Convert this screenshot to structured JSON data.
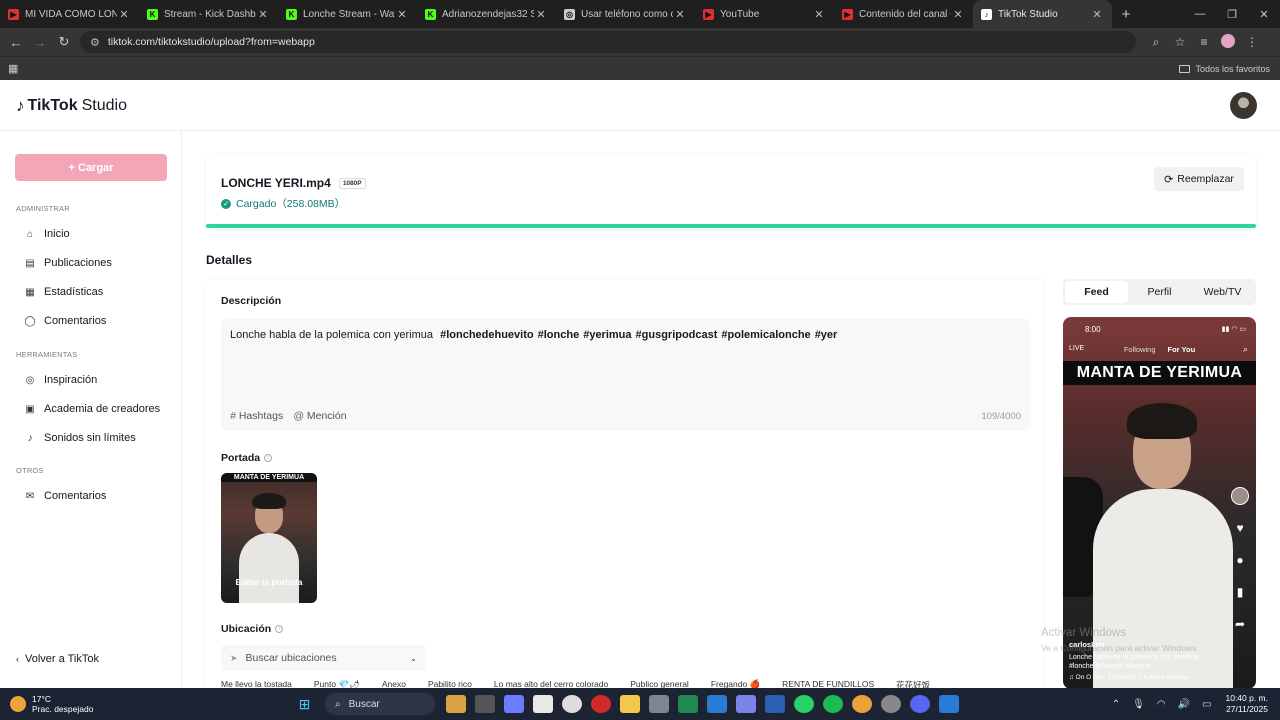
{
  "browser": {
    "tabs": [
      {
        "title": "MI VIDA COMO LONCHE",
        "color": "#e03131",
        "glyph": "▶"
      },
      {
        "title": "Stream - Kick Dashboard",
        "color": "#53fc18",
        "glyph": "K"
      },
      {
        "title": "Lonche Stream - Watch Li",
        "color": "#53fc18",
        "glyph": "K"
      },
      {
        "title": "Adrianozendejas32 Stream",
        "color": "#53fc18",
        "glyph": "K"
      },
      {
        "title": "Usar teléfono como cáma",
        "color": "#cccccc",
        "glyph": "◎"
      },
      {
        "title": "YouTube",
        "color": "#e03131",
        "glyph": "▶"
      },
      {
        "title": "Contenido del canal - You",
        "color": "#e03131",
        "glyph": "▶"
      },
      {
        "title": "TikTok Studio",
        "color": "#ffffff",
        "glyph": "♪"
      }
    ],
    "url": "tiktok.com/tiktokstudio/upload?from=webapp",
    "bookmarks_all": "Todos los favoritos"
  },
  "header": {
    "logo_bold": "TikTok",
    "logo_light": "Studio"
  },
  "sidebar": {
    "upload_label": "+ Cargar",
    "sections": [
      {
        "label": "ADMINISTRAR",
        "items": [
          {
            "label": "Inicio",
            "icon": "home-icon",
            "glyph": "⌂"
          },
          {
            "label": "Publicaciones",
            "icon": "posts-icon",
            "glyph": "▤"
          },
          {
            "label": "Estadísticas",
            "icon": "analytics-icon",
            "glyph": "▦"
          },
          {
            "label": "Comentarios",
            "icon": "comments-icon",
            "glyph": "◯"
          }
        ]
      },
      {
        "label": "HERRAMIENTAS",
        "items": [
          {
            "label": "Inspiración",
            "icon": "inspiration-icon",
            "glyph": "◎"
          },
          {
            "label": "Academia de creadores",
            "icon": "academy-icon",
            "glyph": "▣"
          },
          {
            "label": "Sonidos sin límites",
            "icon": "music-icon",
            "glyph": "♪"
          }
        ]
      },
      {
        "label": "OTROS",
        "items": [
          {
            "label": "Comentarios",
            "icon": "feedback-icon",
            "glyph": "✉"
          }
        ]
      }
    ],
    "back_label": "Volver a TikTok"
  },
  "file": {
    "name": "LONCHE YERI.mp4",
    "quality": "1080P",
    "status": "Cargado（258.08MB）",
    "replace_label": "Reemplazar",
    "progress_pct": 100
  },
  "details": {
    "title": "Detalles",
    "description_label": "Descripción",
    "description_text": "Lonche habla de la polemica con yerimua",
    "description_tags": [
      "#lonchedehuevito",
      "#lonche",
      "#yerimua",
      "#gusgripodcast",
      "#polemicalonche",
      "#yer"
    ],
    "hashtags_label": "Hashtags",
    "mention_label": "Mención",
    "counter": "109/4000",
    "cover_label": "Portada",
    "cover_title": "MANTA DE YERIMUA",
    "cover_edit": "Editar la portada",
    "location_label": "Ubicación",
    "location_placeholder": "Buscar ubicaciones",
    "location_chips": [
      "Me llevo la tostada",
      "Punto 💎🌶",
      "Anexo",
      "Pabilito rico",
      "Lo mas alto del cerro colorado",
      "Publico general",
      "Fregando 🍎",
      "RENTA DE FUNDILLOS",
      "花花好饭"
    ]
  },
  "preview": {
    "tabs": [
      {
        "label": "Feed",
        "active": true
      },
      {
        "label": "Perfil",
        "active": false
      },
      {
        "label": "Web/TV",
        "active": false
      }
    ],
    "time": "8:00",
    "feed_following": "Following",
    "feed_foryou": "For You",
    "live": "LIVE",
    "title": "MANTA DE YERIMUA",
    "user": "carlosLim",
    "caption": "Lonche habla de la polemica con yerimua #lonchedehuevito #lonche...",
    "music": "♫ On O Dia · LEGADO 7 & Kane Rodrigu"
  },
  "watermark": {
    "line1": "Activar Windows",
    "line2": "Ve a Configuración para activar Windows."
  },
  "taskbar": {
    "temp": "17°C",
    "weather": "Prac. despejado",
    "search": "Buscar",
    "time": "10:40 p. m.",
    "date": "27/11/2025"
  }
}
